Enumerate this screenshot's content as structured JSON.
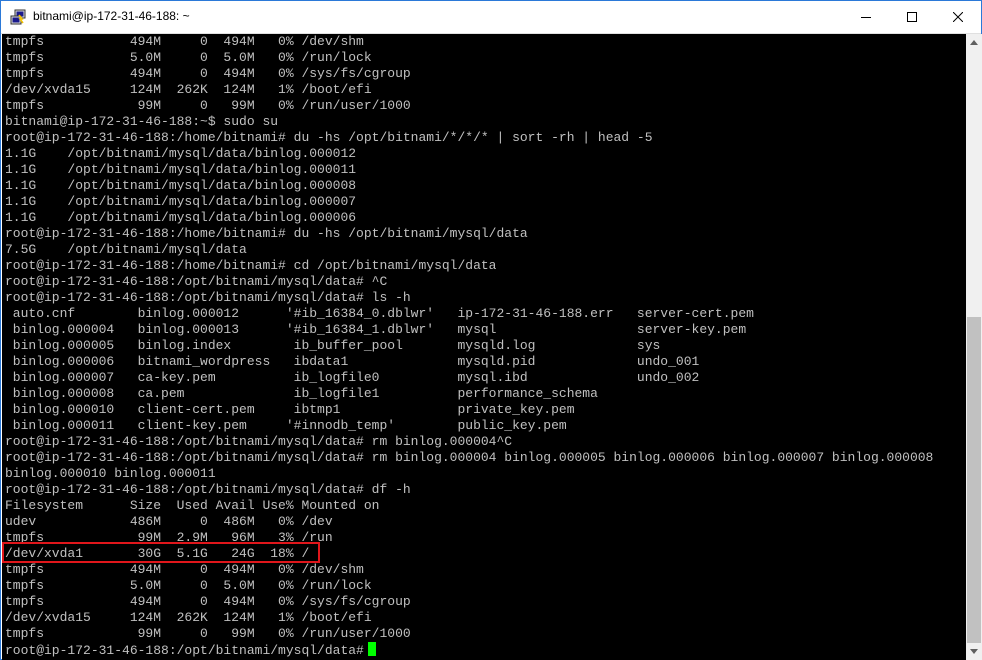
{
  "window": {
    "title": "bitnami@ip-172-31-46-188: ~",
    "icon": "putty-icon"
  },
  "controls": {
    "minimize": "minimize-icon",
    "maximize": "maximize-icon",
    "close": "close-icon"
  },
  "terminal": {
    "lines": [
      "tmpfs           494M     0  494M   0% /dev/shm",
      "tmpfs           5.0M     0  5.0M   0% /run/lock",
      "tmpfs           494M     0  494M   0% /sys/fs/cgroup",
      "/dev/xvda15     124M  262K  124M   1% /boot/efi",
      "tmpfs            99M     0   99M   0% /run/user/1000",
      "bitnami@ip-172-31-46-188:~$ sudo su",
      "root@ip-172-31-46-188:/home/bitnami# du -hs /opt/bitnami/*/*/* | sort -rh | head -5",
      "1.1G    /opt/bitnami/mysql/data/binlog.000012",
      "1.1G    /opt/bitnami/mysql/data/binlog.000011",
      "1.1G    /opt/bitnami/mysql/data/binlog.000008",
      "1.1G    /opt/bitnami/mysql/data/binlog.000007",
      "1.1G    /opt/bitnami/mysql/data/binlog.000006",
      "root@ip-172-31-46-188:/home/bitnami# du -hs /opt/bitnami/mysql/data",
      "7.5G    /opt/bitnami/mysql/data",
      "root@ip-172-31-46-188:/home/bitnami# cd /opt/bitnami/mysql/data",
      "root@ip-172-31-46-188:/opt/bitnami/mysql/data# ^C",
      "root@ip-172-31-46-188:/opt/bitnami/mysql/data# ls -h",
      " auto.cnf        binlog.000012      '#ib_16384_0.dblwr'   ip-172-31-46-188.err   server-cert.pem",
      " binlog.000004   binlog.000013      '#ib_16384_1.dblwr'   mysql                  server-key.pem",
      " binlog.000005   binlog.index        ib_buffer_pool       mysqld.log             sys",
      " binlog.000006   bitnami_wordpress   ibdata1              mysqld.pid             undo_001",
      " binlog.000007   ca-key.pem          ib_logfile0          mysql.ibd              undo_002",
      " binlog.000008   ca.pem              ib_logfile1          performance_schema",
      " binlog.000010   client-cert.pem     ibtmp1               private_key.pem",
      " binlog.000011   client-key.pem     '#innodb_temp'        public_key.pem",
      "root@ip-172-31-46-188:/opt/bitnami/mysql/data# rm binlog.000004^C",
      "root@ip-172-31-46-188:/opt/bitnami/mysql/data# rm binlog.000004 binlog.000005 binlog.000006 binlog.000007 binlog.000008",
      "binlog.000010 binlog.000011",
      "root@ip-172-31-46-188:/opt/bitnami/mysql/data# df -h",
      "Filesystem      Size  Used Avail Use% Mounted on",
      "udev            486M     0  486M   0% /dev",
      "tmpfs            99M  2.9M   96M   3% /run",
      "/dev/xvda1       30G  5.1G   24G  18% /",
      "tmpfs           494M     0  494M   0% /dev/shm",
      "tmpfs           5.0M     0  5.0M   0% /run/lock",
      "tmpfs           494M     0  494M   0% /sys/fs/cgroup",
      "/dev/xvda15     124M  262K  124M   1% /boot/efi",
      "tmpfs            99M     0   99M   0% /run/user/1000"
    ],
    "prompt": "root@ip-172-31-46-188:/opt/bitnami/mysql/data#",
    "text_color": "#c0c0c0",
    "background": "#000000",
    "cursor_color": "#00ff00",
    "highlight_color": "#e0161b"
  }
}
